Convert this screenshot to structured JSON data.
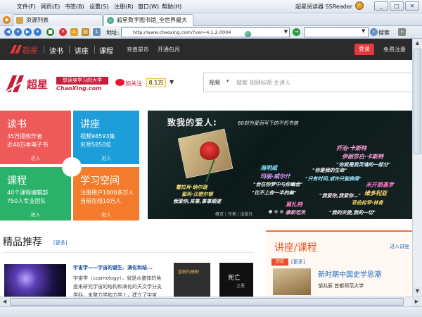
{
  "menubar": {
    "items": [
      "文件(F)",
      "网页(E)",
      "书签(B)",
      "设置(S)",
      "注册(R)",
      "窗口(W)",
      "帮助(H)"
    ],
    "brand": "超星阅读器 SSReader"
  },
  "tabs": [
    {
      "label": "资源列表"
    },
    {
      "label": "超星数字图书馆_全世界最大"
    }
  ],
  "addressbar": {
    "label": "地址:",
    "url": "http://www.chaoxing.com/?ver=4.1.2.0004",
    "search_label": "搜索"
  },
  "site": {
    "nav": [
      "读书",
      "讲座",
      "课程"
    ],
    "nav2": [
      "充值星币",
      "开通包月"
    ],
    "login": "登录",
    "register": "免费注册",
    "slogan": "想读身学习的大学",
    "domain": "ChaoXing.com",
    "follow": "加关注",
    "followers": "8.1万",
    "search_category": "视频",
    "search_placeholder": "搜索 视频标题 主讲人"
  },
  "tiles": [
    {
      "title": "读书",
      "line1": "35万授权作者",
      "line2": "近40万本电子书",
      "enter": "进入",
      "color": "#ee5a5a"
    },
    {
      "title": "讲座",
      "line1": "视频98593集",
      "line2": "名师5850位",
      "enter": "进入",
      "color": "#1e9ed8"
    },
    {
      "title": "课程",
      "line1": "40个课程编辑部",
      "line2": "750人专业团队",
      "enter": "进入",
      "color": "#2ab26a"
    },
    {
      "title": "学习空间",
      "line1": "注册用户1000多万人",
      "line2": "当前在线10万人",
      "enter": "进入",
      "color": "#f47b2b"
    }
  ],
  "banner": {
    "title": "致我的爱人:",
    "subtitle": "60封为爱而写下的不朽书信",
    "names": [
      "海明威",
      "乔治·卡斯特",
      "伊丽莎白·卡斯特",
      "霍拉肖·纳尔逊",
      "爱玛·汉密尔顿",
      "玛丽·威尔什",
      "米开朗基罗",
      "莫扎特",
      "维多利亚",
      "康斯坦茨",
      "亚伯拉罕·林肯"
    ],
    "quotes": [
      "我爱你,来事,事事顺遂",
      "\"会在你梦中与你幽会\"",
      "\"你是我的生命\"",
      "\"比不上你一半的美\"",
      "\"我的天使,我的一切\"",
      "\"只有时间,或许只能换得\"",
      "\"你就是我灵魂的一部分\"",
      "\"我爱你,我爱你…\""
    ],
    "meta": "概览 | 作者 | 出版社"
  },
  "featured": {
    "title": "精品推荐",
    "more": "[更多]",
    "book_title": "宇宙学——宇宙的诞生、演化和结...",
    "book_desc": "宇宙学（cosmology），就是从整体的角度来研究宇宙的结构和演化的天文学分支学科，未整力学和力学上，建立了宇宙的...",
    "thumb1_title": "蓝鲸的睡眠",
    "thumb2_title": "死亡",
    "thumb2_sub": "之恩"
  },
  "lecture": {
    "title": "讲座/课程",
    "more": "进入讲座",
    "tag": "历史",
    "tag2": "[更多]",
    "name": "新时期中国史学思潮",
    "person": "邹兆辰 首都师范大学"
  }
}
